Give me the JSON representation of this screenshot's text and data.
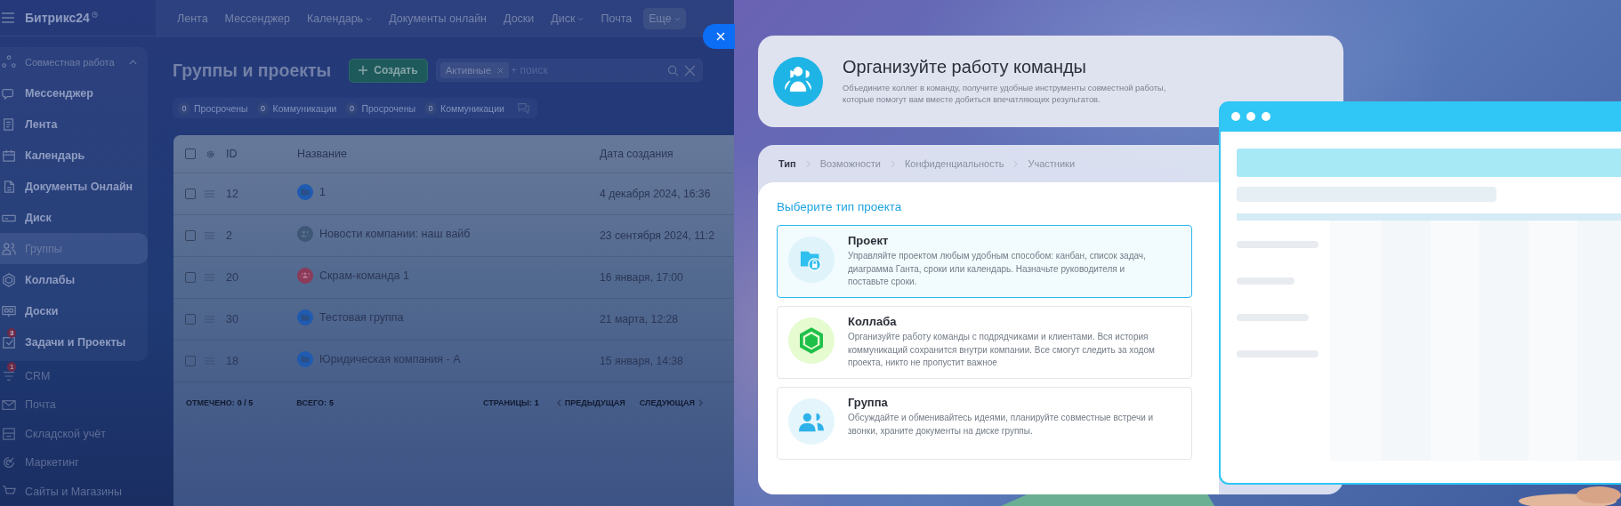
{
  "app": {
    "logo": "Битрикс24"
  },
  "sidebar": {
    "section": {
      "label": "Совместная работа",
      "expanded": true,
      "items": [
        {
          "label": "Мессенджер",
          "selected": false
        },
        {
          "label": "Лента",
          "selected": false
        },
        {
          "label": "Календарь",
          "selected": false
        },
        {
          "label": "Документы Онлайн",
          "selected": false
        },
        {
          "label": "Диск",
          "selected": false
        },
        {
          "label": "Группы",
          "selected": true
        },
        {
          "label": "Коллабы",
          "selected": false
        },
        {
          "label": "Доски",
          "selected": false
        },
        {
          "label": "Задачи и Проекты",
          "selected": false,
          "badge": "3"
        }
      ]
    },
    "items": [
      {
        "label": "CRM",
        "selected": false,
        "badge": "1"
      },
      {
        "label": "Почта",
        "selected": false
      },
      {
        "label": "Складской учёт",
        "selected": false
      },
      {
        "label": "Маркетинг",
        "selected": false
      },
      {
        "label": "Сайты и Магазины",
        "selected": false
      }
    ]
  },
  "top_nav": [
    {
      "label": "Лента",
      "dropdown": false,
      "selected": false
    },
    {
      "label": "Мессенджер",
      "dropdown": false,
      "selected": false
    },
    {
      "label": "Календарь",
      "dropdown": true,
      "selected": false
    },
    {
      "label": "Документы онлайн",
      "dropdown": false,
      "selected": false
    },
    {
      "label": "Доски",
      "dropdown": false,
      "selected": false
    },
    {
      "label": "Диск",
      "dropdown": true,
      "selected": false
    },
    {
      "label": "Почта",
      "dropdown": false,
      "selected": false
    },
    {
      "label": "Еще",
      "dropdown": true,
      "selected": true
    }
  ],
  "page": {
    "title": "Группы и проекты",
    "create_button": "Создать",
    "filter": {
      "tag": "Активные",
      "placeholder": "+ поиск"
    },
    "counters": [
      {
        "count": "0",
        "label": "Просрочены"
      },
      {
        "count": "0",
        "label": "Коммуникации"
      },
      {
        "count": "0",
        "label": "Просрочены"
      },
      {
        "count": "0",
        "label": "Коммуникации"
      }
    ]
  },
  "table": {
    "all_checked": false,
    "columns": [
      "ID",
      "Название",
      "Дата создания"
    ],
    "rows": [
      {
        "checked": false,
        "id": "12",
        "kind": "folder",
        "name": "1",
        "date": "4 декабря 2024, 16:36"
      },
      {
        "checked": false,
        "id": "2",
        "kind": "group",
        "name": "Новости компании: наш вайб",
        "date": "23 сентября 2024, 11:2"
      },
      {
        "checked": false,
        "id": "20",
        "kind": "scrum",
        "name": "Скрам-команда 1",
        "date": "16 января, 17:00"
      },
      {
        "checked": false,
        "id": "30",
        "kind": "folder",
        "name": "Тестовая группа",
        "date": "21 марта, 12:28"
      },
      {
        "checked": false,
        "id": "18",
        "kind": "folder",
        "name": "Юридическая компания - А",
        "date": "15 января, 14:38"
      }
    ],
    "footer": {
      "selected_label": "ОТМЕЧЕНО:",
      "selected_value": "0 / 5",
      "total_label": "ВСЕГО:",
      "total_value": "5",
      "pages_label": "СТРАНИЦЫ:",
      "pages_value": "1",
      "prev": "ПРЕДЫДУЩАЯ",
      "next": "СЛЕДУЮЩАЯ"
    }
  },
  "modal": {
    "header": {
      "title": "Организуйте работу команды",
      "text": "Объедините коллег в команду, получите удобные инструменты совместной работы, которые помогут вам вместе добиться впечатляющих результатов."
    },
    "steps": [
      {
        "label": "Тип",
        "selected": true
      },
      {
        "label": "Возможности",
        "selected": false
      },
      {
        "label": "Конфиденциальность",
        "selected": false
      },
      {
        "label": "Участники",
        "selected": false
      }
    ],
    "prompt": "Выберите тип проекта",
    "options": [
      {
        "kind": "project",
        "title": "Проект",
        "text": "Управляйте проектом любым удобным способом: канбан, список задач, диаграмма Ганта, сроки или календарь. Назначьте руководителя и поставьте сроки.",
        "selected": true
      },
      {
        "kind": "collab",
        "title": "Коллаба",
        "text": "Организуйте работу команды с подрядчиками и клиентами. Вся история коммуникаций сохранится внутри компании. Все смогут следить за ходом проекта, никто не пропустит важное",
        "selected": false
      },
      {
        "kind": "group",
        "title": "Группа",
        "text": "Обсуждайте и обменивайтесь идеями, планируйте совместные встречи и звонки, храните документы на диске группы.",
        "selected": false
      }
    ]
  }
}
